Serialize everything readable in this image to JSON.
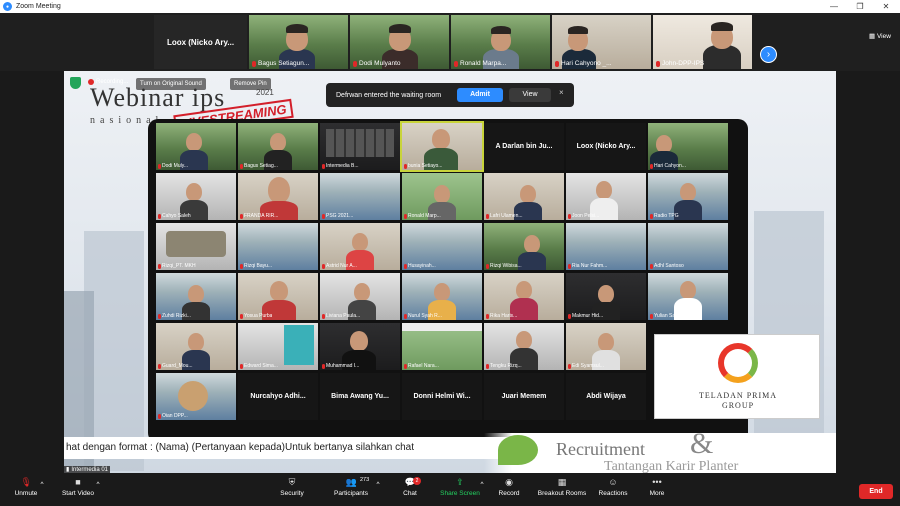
{
  "window": {
    "title": "Zoom Meeting"
  },
  "strip": {
    "first_name": "Loox (Nicko Ary...",
    "tiles": [
      {
        "name": "Bagus Setiagun..."
      },
      {
        "name": "Dodi Mulyanto"
      },
      {
        "name": "Ronald Marpa..."
      },
      {
        "name": "Hari Cahyono _..."
      },
      {
        "name": "John-DPP-IPS"
      }
    ],
    "view_label": "View"
  },
  "share": {
    "recording": "Recording...",
    "turn_on_sound": "Turn on Original Sound",
    "remove_pin": "Remove Pin",
    "webinar_title": "Webinar ips",
    "webinar_subtitle": "nasional",
    "year": "2021",
    "livestreaming": "LIVESTREAMING",
    "waiting": {
      "message": "Defrwan entered the waiting room",
      "admit": "Admit",
      "view": "View",
      "close": "×"
    },
    "gallery": [
      {
        "name": "Dodi Muly..."
      },
      {
        "name": "Bagus Setiag..."
      },
      {
        "name": "Intermedia B..."
      },
      {
        "name": "bunia Setiayo..."
      },
      {
        "name": "A Darlan bin Ju..."
      },
      {
        "name": "Loox (Nicko Ary..."
      },
      {
        "name": "Hari Cahyon..."
      },
      {
        "name": "Cahyo Saleh"
      },
      {
        "name": "FRANDA RIR..."
      },
      {
        "name": "PSG 2021..."
      },
      {
        "name": "Ronald Marp..."
      },
      {
        "name": "Lafri Ulamen..."
      },
      {
        "name": "Joon Pelsi..."
      },
      {
        "name": "Radio TPG"
      },
      {
        "name": "Rizqi_PT. MKH"
      },
      {
        "name": "Rizqi Bayu..."
      },
      {
        "name": "Astrid Nur A..."
      },
      {
        "name": "Husayinah..."
      },
      {
        "name": "Rizqi Wibisa..."
      },
      {
        "name": "Ria Nur Fahm..."
      },
      {
        "name": "Adhl Santoso"
      },
      {
        "name": "Zuhdi Rizki..."
      },
      {
        "name": "Yosua Purba"
      },
      {
        "name": "Liviana Paula..."
      },
      {
        "name": "Nurul Syah R..."
      },
      {
        "name": "Rika Haris..."
      },
      {
        "name": "Makmur Hid..."
      },
      {
        "name": "Yulian Sasmi..."
      },
      {
        "name": "Guard_Mou..."
      },
      {
        "name": "Edward Sima..."
      },
      {
        "name": "Muhammad I..."
      },
      {
        "name": "Rafael Nara..."
      },
      {
        "name": "Tengku Rizq..."
      },
      {
        "name": "Edi Syamsul..."
      },
      {
        "name": "Oian DPP..."
      },
      {
        "name": "Nurcahyo Adhi..."
      },
      {
        "name": "Bima Awang Yu..."
      },
      {
        "name": "Donni Helmi Wi..."
      },
      {
        "name": "Juari Memem"
      },
      {
        "name": "Abdi Wijaya"
      }
    ],
    "tpg_line1": "TELADAN PRIMA",
    "tpg_line2": "GROUP",
    "ticker": "hat dengan format : (Nama) (Pertanyaan kepada)Untuk bertanya silahkan chat",
    "recruitment": "Recruitment",
    "amp": "&",
    "recruit_line2": "Tantangan Karir Planter",
    "intermedia": "Intermedia 01"
  },
  "toolbar": {
    "unmute": "Unmute",
    "start_video": "Start Video",
    "security": "Security",
    "participants": "Participants",
    "participants_count": "273",
    "chat": "Chat",
    "chat_badge": "2",
    "share_screen": "Share Screen",
    "record": "Record",
    "breakout": "Breakout Rooms",
    "reactions": "Reactions",
    "more": "More",
    "end": "End"
  }
}
